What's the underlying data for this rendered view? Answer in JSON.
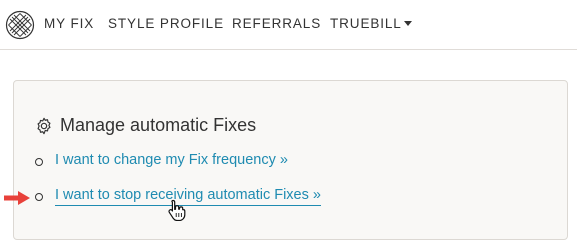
{
  "nav": {
    "logo_icon": "stitch-fix-logo-icon",
    "items": [
      {
        "label": "MY FIX"
      },
      {
        "label": "STYLE PROFILE"
      },
      {
        "label": "REFERRALS"
      },
      {
        "label": "TRUEBILL",
        "icon": "caret-down-icon"
      }
    ]
  },
  "card": {
    "icon": "gear-icon",
    "title": "Manage automatic Fixes",
    "options": [
      {
        "label": "I want to change my Fix frequency »"
      },
      {
        "label": "I want to stop receiving automatic Fixes »"
      }
    ]
  },
  "annotations": {
    "arrow_icon": "red-arrow-icon",
    "cursor_icon": "hand-pointer-cursor-icon"
  },
  "colors": {
    "link": "#1f8bb1",
    "text": "#333333",
    "card_bg": "#f9f8f6",
    "card_border": "#dcd8d3",
    "arrow": "#e8413a"
  }
}
